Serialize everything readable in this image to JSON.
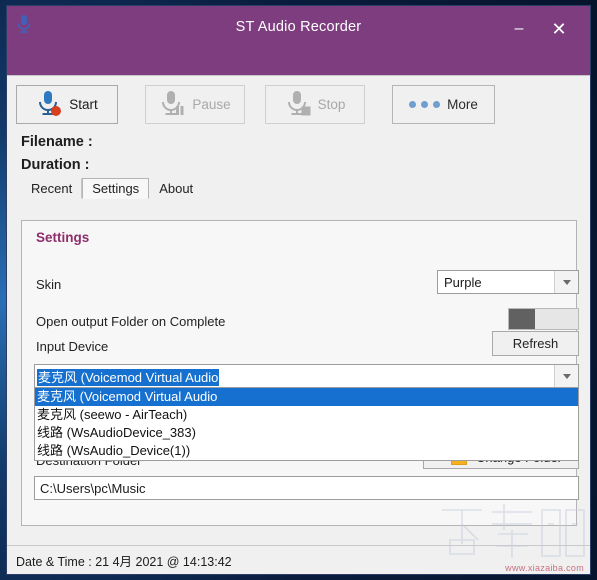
{
  "window": {
    "title": "ST Audio Recorder",
    "app_icon": "microphone-icon",
    "minimize_label": "–",
    "close_label": "✕",
    "titlebar_color": "#7d3d7f"
  },
  "toolbar": {
    "start_label": "Start",
    "pause_label": "Pause",
    "stop_label": "Stop",
    "more_label": "More"
  },
  "info": {
    "filename_label": "Filename :",
    "duration_label": "Duration :"
  },
  "tabs": [
    {
      "label": "Recent",
      "selected": false
    },
    {
      "label": "Settings",
      "selected": true
    },
    {
      "label": "About",
      "selected": false
    }
  ],
  "settings": {
    "panel_title": "Settings",
    "skin_label": "Skin",
    "skin_value": "Purple",
    "open_folder_label": "Open output Folder on Complete",
    "open_folder_state": "off",
    "input_device_label": "Input Device",
    "refresh_label": "Refresh",
    "device_selected_text": "麦克风 (Voicemod Virtual Audio",
    "device_options": [
      "麦克风 (Voicemod Virtual Audio",
      "麦克风 (seewo - AirTeach)",
      "线路 (WsAudioDevice_383)",
      "线路 (WsAudio_Device(1))"
    ],
    "device_selected_index": 0,
    "destination_label": "Destination Folder",
    "change_folder_label": "Change Folder",
    "change_folder_icon": "music-note-folder-icon",
    "destination_path": "C:\\Users\\pc\\Music"
  },
  "statusbar": {
    "text": "Date & Time : 21 4月 2021 @ 14:13:42"
  },
  "watermark": {
    "text": "下载吧",
    "url": "www.xiazaiba.com"
  }
}
